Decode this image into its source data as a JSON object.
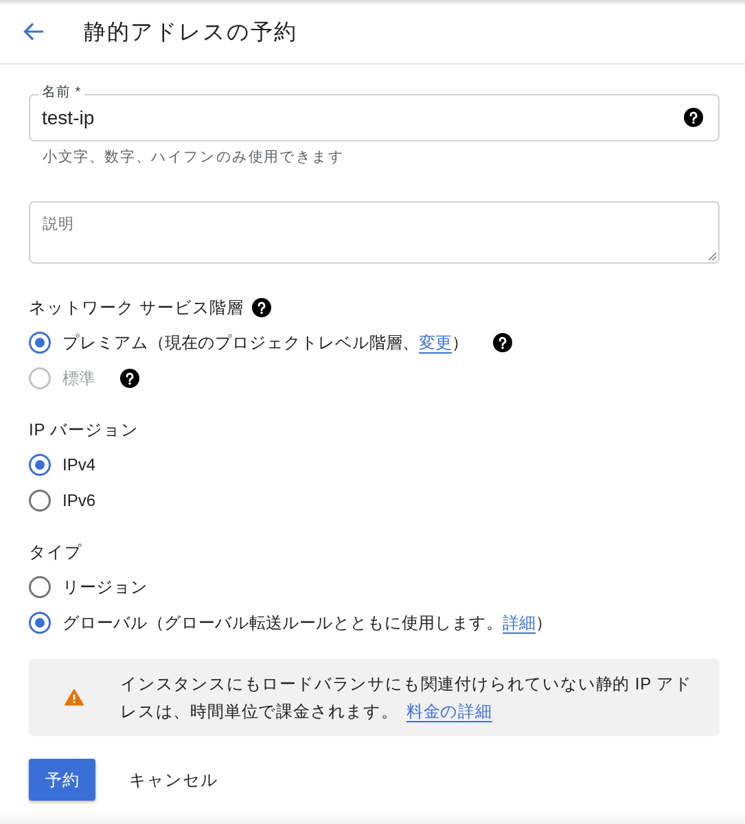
{
  "header": {
    "title": "静的アドレスの予約"
  },
  "name_field": {
    "label": "名前 *",
    "value": "test-ip",
    "help": true,
    "hint": "小文字、数字、ハイフンのみ使用できます"
  },
  "description_field": {
    "placeholder": "説明"
  },
  "sections": [
    {
      "title": "ネットワーク サービス階層",
      "help": true,
      "options": [
        {
          "label": "プレミアム（現在のプロジェクトレベル階層、",
          "link": "変更",
          "suffix": "）",
          "selected": true,
          "disabled": false,
          "help": true
        },
        {
          "label": "標準",
          "selected": false,
          "disabled": true,
          "help": true
        }
      ]
    },
    {
      "title": "IP バージョン",
      "help": false,
      "options": [
        {
          "label": "IPv4",
          "selected": true,
          "disabled": false,
          "help": false
        },
        {
          "label": "IPv6",
          "selected": false,
          "disabled": false,
          "help": false
        }
      ]
    },
    {
      "title": "タイプ",
      "help": false,
      "options": [
        {
          "label": "リージョン",
          "selected": false,
          "disabled": false,
          "help": false
        },
        {
          "label": "グローバル（グローバル転送ルールとともに使用します。",
          "link": "詳細",
          "suffix": "）",
          "selected": true,
          "disabled": false,
          "help": false
        }
      ]
    }
  ],
  "notice": {
    "text": "インスタンスにもロードバランサにも関連付けられていない静的 IP アドレスは、時間単位で課金されます。",
    "link": "料金の詳細"
  },
  "actions": [
    {
      "label": "予約",
      "kind": "primary"
    },
    {
      "label": "キャンセル",
      "kind": "text"
    }
  ]
}
